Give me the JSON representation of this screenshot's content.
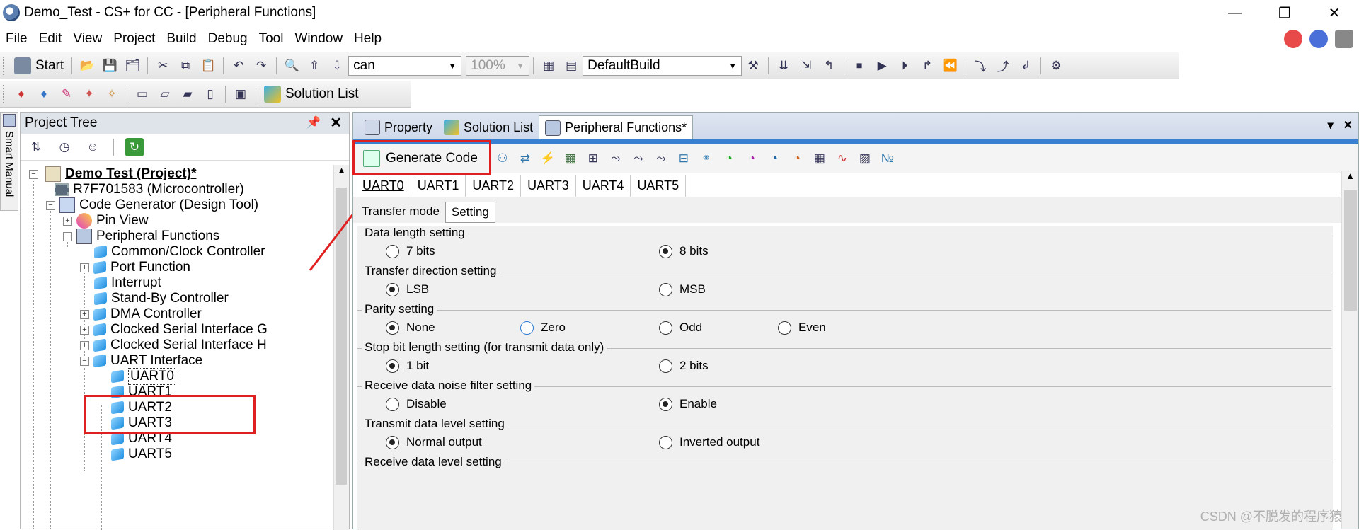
{
  "window": {
    "title": "Demo_Test - CS+ for CC - [Peripheral Functions]",
    "minimize": "—",
    "restore": "❐",
    "close": "✕"
  },
  "menu": [
    "File",
    "Edit",
    "View",
    "Project",
    "Build",
    "Debug",
    "Tool",
    "Window",
    "Help"
  ],
  "toolbar": {
    "start_label": "Start",
    "search_value": "can",
    "zoom_value": "100%",
    "build_config": "DefaultBuild",
    "solution_list_label": "Solution List"
  },
  "side_tab": {
    "label": "Smart Manual"
  },
  "project_tree": {
    "header": "Project Tree",
    "nodes": [
      {
        "label": "Demo Test (Project)*"
      },
      {
        "label": "R7F701583 (Microcontroller)"
      },
      {
        "label": "Code Generator (Design Tool)"
      },
      {
        "label": "Pin View"
      },
      {
        "label": "Peripheral Functions"
      },
      {
        "label": "Common/Clock Controller"
      },
      {
        "label": "Port Function"
      },
      {
        "label": "Interrupt"
      },
      {
        "label": "Stand-By Controller"
      },
      {
        "label": "DMA Controller"
      },
      {
        "label": "Clocked Serial Interface G"
      },
      {
        "label": "Clocked Serial Interface H"
      },
      {
        "label": "UART Interface"
      },
      {
        "label": "UART0"
      },
      {
        "label": "UART1"
      },
      {
        "label": "UART2"
      },
      {
        "label": "UART3"
      },
      {
        "label": "UART4"
      },
      {
        "label": "UART5"
      }
    ]
  },
  "panel_tabs": [
    {
      "label": "Property"
    },
    {
      "label": "Solution List"
    },
    {
      "label": "Peripheral Functions*"
    }
  ],
  "panel_controls": {
    "dropdown": "▾",
    "close": "✕"
  },
  "generate_code_label": "Generate Code",
  "uart_tabs": [
    "UART0",
    "UART1",
    "UART2",
    "UART3",
    "UART4",
    "UART5"
  ],
  "sub_tabs": [
    "Transfer mode",
    "Setting"
  ],
  "settings": [
    {
      "title": "Data length setting",
      "options": [
        {
          "label": "7 bits",
          "checked": false
        },
        {
          "label": "8 bits",
          "checked": true
        }
      ]
    },
    {
      "title": "Transfer direction setting",
      "options": [
        {
          "label": "LSB",
          "checked": true
        },
        {
          "label": "MSB",
          "checked": false
        }
      ]
    },
    {
      "title": "Parity setting",
      "options": [
        {
          "label": "None",
          "checked": true
        },
        {
          "label": "Zero",
          "checked": false
        },
        {
          "label": "Odd",
          "checked": false
        },
        {
          "label": "Even",
          "checked": false
        }
      ]
    },
    {
      "title": "Stop bit length setting (for transmit data only)",
      "options": [
        {
          "label": "1 bit",
          "checked": true
        },
        {
          "label": "2 bits",
          "checked": false
        }
      ]
    },
    {
      "title": "Receive data noise filter setting",
      "options": [
        {
          "label": "Disable",
          "checked": false
        },
        {
          "label": "Enable",
          "checked": true
        }
      ]
    },
    {
      "title": "Transmit data level setting",
      "options": [
        {
          "label": "Normal output",
          "checked": true
        },
        {
          "label": "Inverted output",
          "checked": false
        }
      ]
    },
    {
      "title": "Receive data level setting",
      "options": []
    }
  ],
  "watermark": "CSDN @不脱发的程序猿",
  "colors": {
    "highlight": "#e02020",
    "accent": "#3a80d0"
  }
}
